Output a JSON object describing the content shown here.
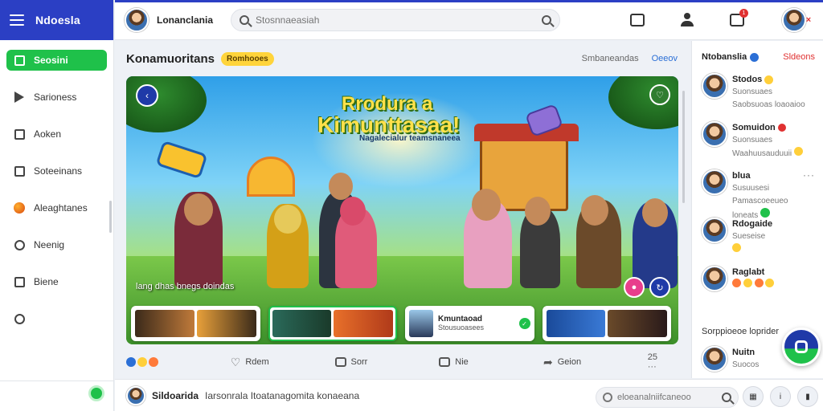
{
  "app": {
    "name": "Ndoesla"
  },
  "sidebar": {
    "items": [
      {
        "label": "Seosini",
        "icon": "home-icon",
        "active": true
      },
      {
        "label": "Sarioness",
        "icon": "play-icon",
        "active": false
      },
      {
        "label": "Aoken",
        "icon": "grid-icon",
        "active": false
      },
      {
        "label": "Soteeinans",
        "icon": "bookmark-icon",
        "active": false
      },
      {
        "label": "Aleaghtanes",
        "icon": "fruit-icon",
        "active": false
      },
      {
        "label": "Neenig",
        "icon": "clock-icon",
        "active": false
      },
      {
        "label": "Biene",
        "icon": "list-icon",
        "active": false
      },
      {
        "label": "",
        "icon": "settings-icon",
        "active": false
      }
    ]
  },
  "topbar": {
    "user_name": "Lonanclania",
    "search_placeholder": "Stosnnaeasiah",
    "notification_count": "1"
  },
  "main": {
    "title": "Konamuoritans",
    "pill": "Romhooes",
    "link_a": "Smbaneandas",
    "link_b": "Oeeov",
    "hero": {
      "headline_1": "Rrodura a",
      "headline_2": "Kimunttasaa!",
      "subtitle": "Nagalecialur teamsnaneea",
      "caption": "lang dhas bnegs doindas"
    },
    "thumbnails": [
      {
        "kind": "image"
      },
      {
        "kind": "image",
        "selected": true
      },
      {
        "kind": "text",
        "title": "Kmuntaoad",
        "subtitle": "Stousuoasees"
      },
      {
        "kind": "image"
      }
    ],
    "actions": [
      {
        "label": "Rdem",
        "icon": "heart-icon"
      },
      {
        "label": "Sorr",
        "icon": "comment-icon"
      },
      {
        "label": "Nie",
        "icon": "square-icon"
      },
      {
        "label": "Geion",
        "icon": "share-icon"
      }
    ],
    "reaction_count": "25 ···"
  },
  "rightpanel": {
    "title": "Ntobanslia",
    "action": "Sldeons",
    "people": [
      {
        "name": "Stodos",
        "status": "Suonsuaes",
        "badge": "emoji"
      },
      {
        "name": "Somuidon",
        "status": "Suonsuaes",
        "badge": "red"
      },
      {
        "name": "blua",
        "status": "Susuusesi",
        "badge": "none",
        "more": "···"
      },
      {
        "name": "Rdogaide",
        "status": "Sueseise",
        "badge": "none"
      },
      {
        "name": "Raglabt",
        "status": "",
        "badge": "emojis"
      }
    ],
    "people_extra": [
      "Saobsuoas loaoaioo",
      "Waahuusauduuii",
      "Pamascoeeueo loneats",
      "Sueseise"
    ],
    "section_title": "Sorppioeoe loprider",
    "last_person": {
      "name": "Nuitn",
      "status": "Suocos"
    }
  },
  "bottombar": {
    "user_name": "Sildoarida",
    "message": "Iarsonrala Itoatanagomita konaeana",
    "search_placeholder": "eloeanalniifcaneoo"
  }
}
